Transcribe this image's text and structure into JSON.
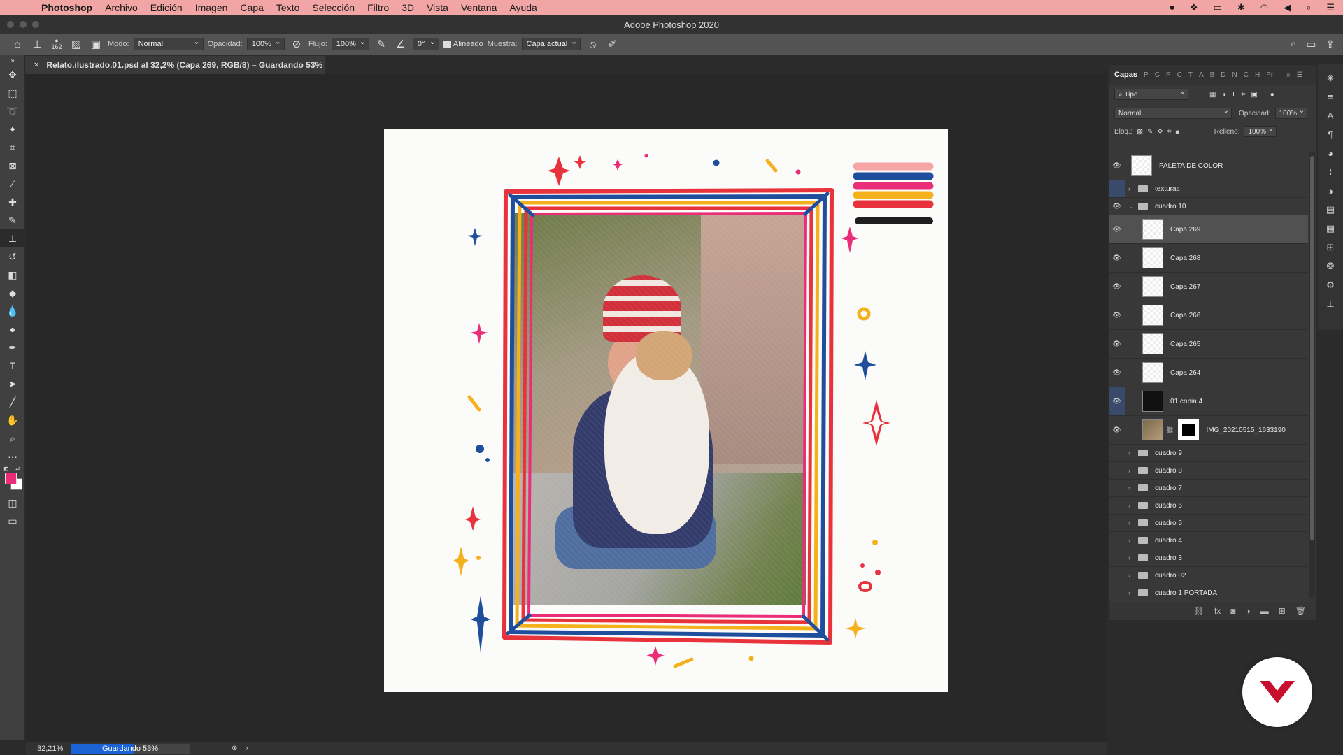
{
  "menubar": {
    "app": "Photoshop",
    "items": [
      "Archivo",
      "Edición",
      "Imagen",
      "Capa",
      "Texto",
      "Selección",
      "Filtro",
      "3D",
      "Vista",
      "Ventana",
      "Ayuda"
    ]
  },
  "window": {
    "title": "Adobe Photoshop 2020"
  },
  "options": {
    "brush_size": "162",
    "mode_label": "Modo:",
    "mode_value": "Normal",
    "opacity_label": "Opacidad:",
    "opacity_value": "100%",
    "flow_label": "Flujo:",
    "flow_value": "100%",
    "angle_value": "0°",
    "aligned_label": "Alineado",
    "sample_label": "Muestra:",
    "sample_value": "Capa actual"
  },
  "doc_tab": {
    "title": "Relato.ilustrado.01.psd al 32,2% (Capa 269, RGB/8) – Guardando 53%"
  },
  "layers": {
    "tab_active": "Capas",
    "tabs_other": [
      "P",
      "C",
      "P",
      "C",
      "T",
      "A",
      "B",
      "D",
      "N",
      "C",
      "H",
      "Pr"
    ],
    "filter": "Tipo",
    "blend": "Normal",
    "opacity_label": "Opacidad:",
    "opacity": "100%",
    "lock_label": "Bloq.:",
    "fill_label": "Relleno:",
    "fill": "100%",
    "list": [
      {
        "name": "PALETA DE COLOR",
        "type": "layer",
        "visible": true
      },
      {
        "name": "texturas",
        "type": "group",
        "visible": false
      },
      {
        "name": "cuadro 10",
        "type": "group-open",
        "visible": true
      },
      {
        "name": "Capa 269",
        "type": "layer",
        "visible": true,
        "selected": true,
        "indent": true
      },
      {
        "name": "Capa 268",
        "type": "layer",
        "visible": true,
        "indent": true
      },
      {
        "name": "Capa 267",
        "type": "layer",
        "visible": true,
        "indent": true
      },
      {
        "name": "Capa 266",
        "type": "layer",
        "visible": true,
        "indent": true
      },
      {
        "name": "Capa 265",
        "type": "layer",
        "visible": true,
        "indent": true
      },
      {
        "name": "Capa 264",
        "type": "layer",
        "visible": true,
        "indent": true
      },
      {
        "name": "01 copia 4",
        "type": "layer",
        "visible": true,
        "indent": true,
        "dark": true
      },
      {
        "name": "IMG_20210515_1633190",
        "type": "layer",
        "visible": true,
        "indent": true,
        "photo": true
      },
      {
        "name": "cuadro 9",
        "type": "group",
        "visible": false
      },
      {
        "name": "cuadro 8",
        "type": "group",
        "visible": false
      },
      {
        "name": "cuadro 7",
        "type": "group",
        "visible": false
      },
      {
        "name": "cuadro 6",
        "type": "group",
        "visible": false
      },
      {
        "name": "cuadro 5",
        "type": "group",
        "visible": false
      },
      {
        "name": "cuadro 4",
        "type": "group",
        "visible": false
      },
      {
        "name": "cuadro 3",
        "type": "group",
        "visible": false
      },
      {
        "name": "cuadro 02",
        "type": "group",
        "visible": false
      },
      {
        "name": "cuadro 1 PORTADA",
        "type": "group",
        "visible": false
      }
    ]
  },
  "status": {
    "zoom": "32,21%",
    "progress_text": "Guardando 53%",
    "progress_fraction": 0.53
  },
  "colors": {
    "foreground": "#ea2c79",
    "background": "#ffffff",
    "frame_red": "#e8333d",
    "frame_blue": "#1f4f9c",
    "frame_yellow": "#f5b11c",
    "frame_pink": "#ea2c79"
  }
}
